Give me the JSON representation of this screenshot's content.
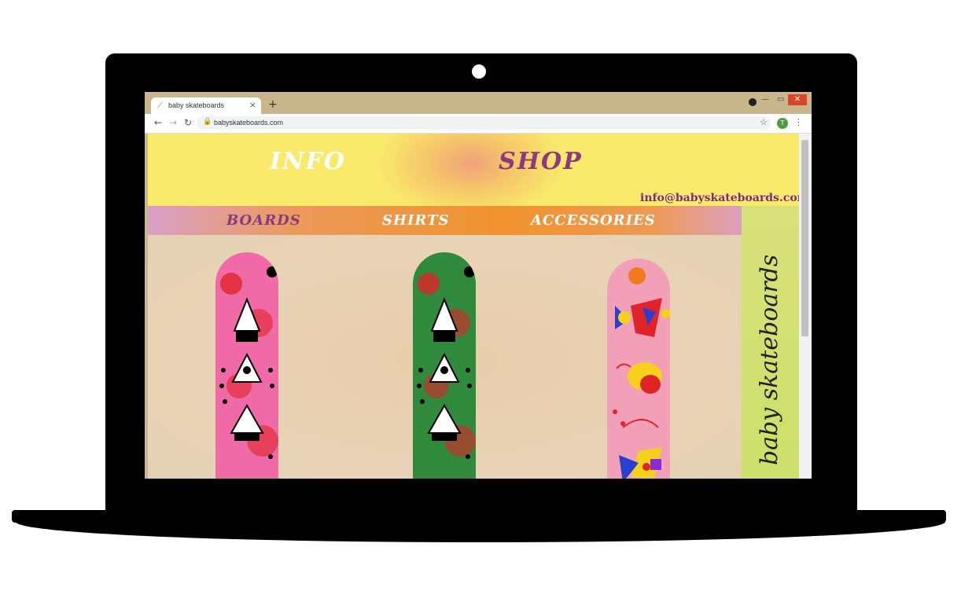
{
  "browser": {
    "tab_title": "baby skateboards",
    "tab_close": "×",
    "new_tab": "+",
    "url": "babyskateboards.com",
    "back": "←",
    "forward": "→",
    "reload": "↻",
    "lock": "🔒",
    "star": "☆",
    "avatar_letter": "T",
    "menu": "⋮",
    "minimize": "▭",
    "close": "✕"
  },
  "header": {
    "nav_info": "INFO",
    "nav_shop": "SHOP",
    "email": "info@babyskateboards.com"
  },
  "subnav": {
    "items": [
      {
        "label": "BOARDS",
        "color": "#8b3a7e"
      },
      {
        "label": "SHIRTS",
        "color": "#ffffff"
      },
      {
        "label": "ACCESSORIES",
        "color": "#ffffff"
      }
    ]
  },
  "side_panel": {
    "brand": "baby skateboards"
  },
  "boards": [
    {
      "base_color": "#f06aa8",
      "accent": "#e0242a",
      "pattern": "figures"
    },
    {
      "base_color": "#2f8a3c",
      "accent": "#e0242a",
      "pattern": "figures"
    },
    {
      "base_color": "#f2a0b8",
      "accent": "#2a3fd0",
      "pattern": "birds"
    }
  ],
  "colors": {
    "header_yellow": "#f9ea6c",
    "subnav_orange": "#f0922e",
    "side_green": "#d8e07a",
    "purple": "#8b3a7e"
  }
}
